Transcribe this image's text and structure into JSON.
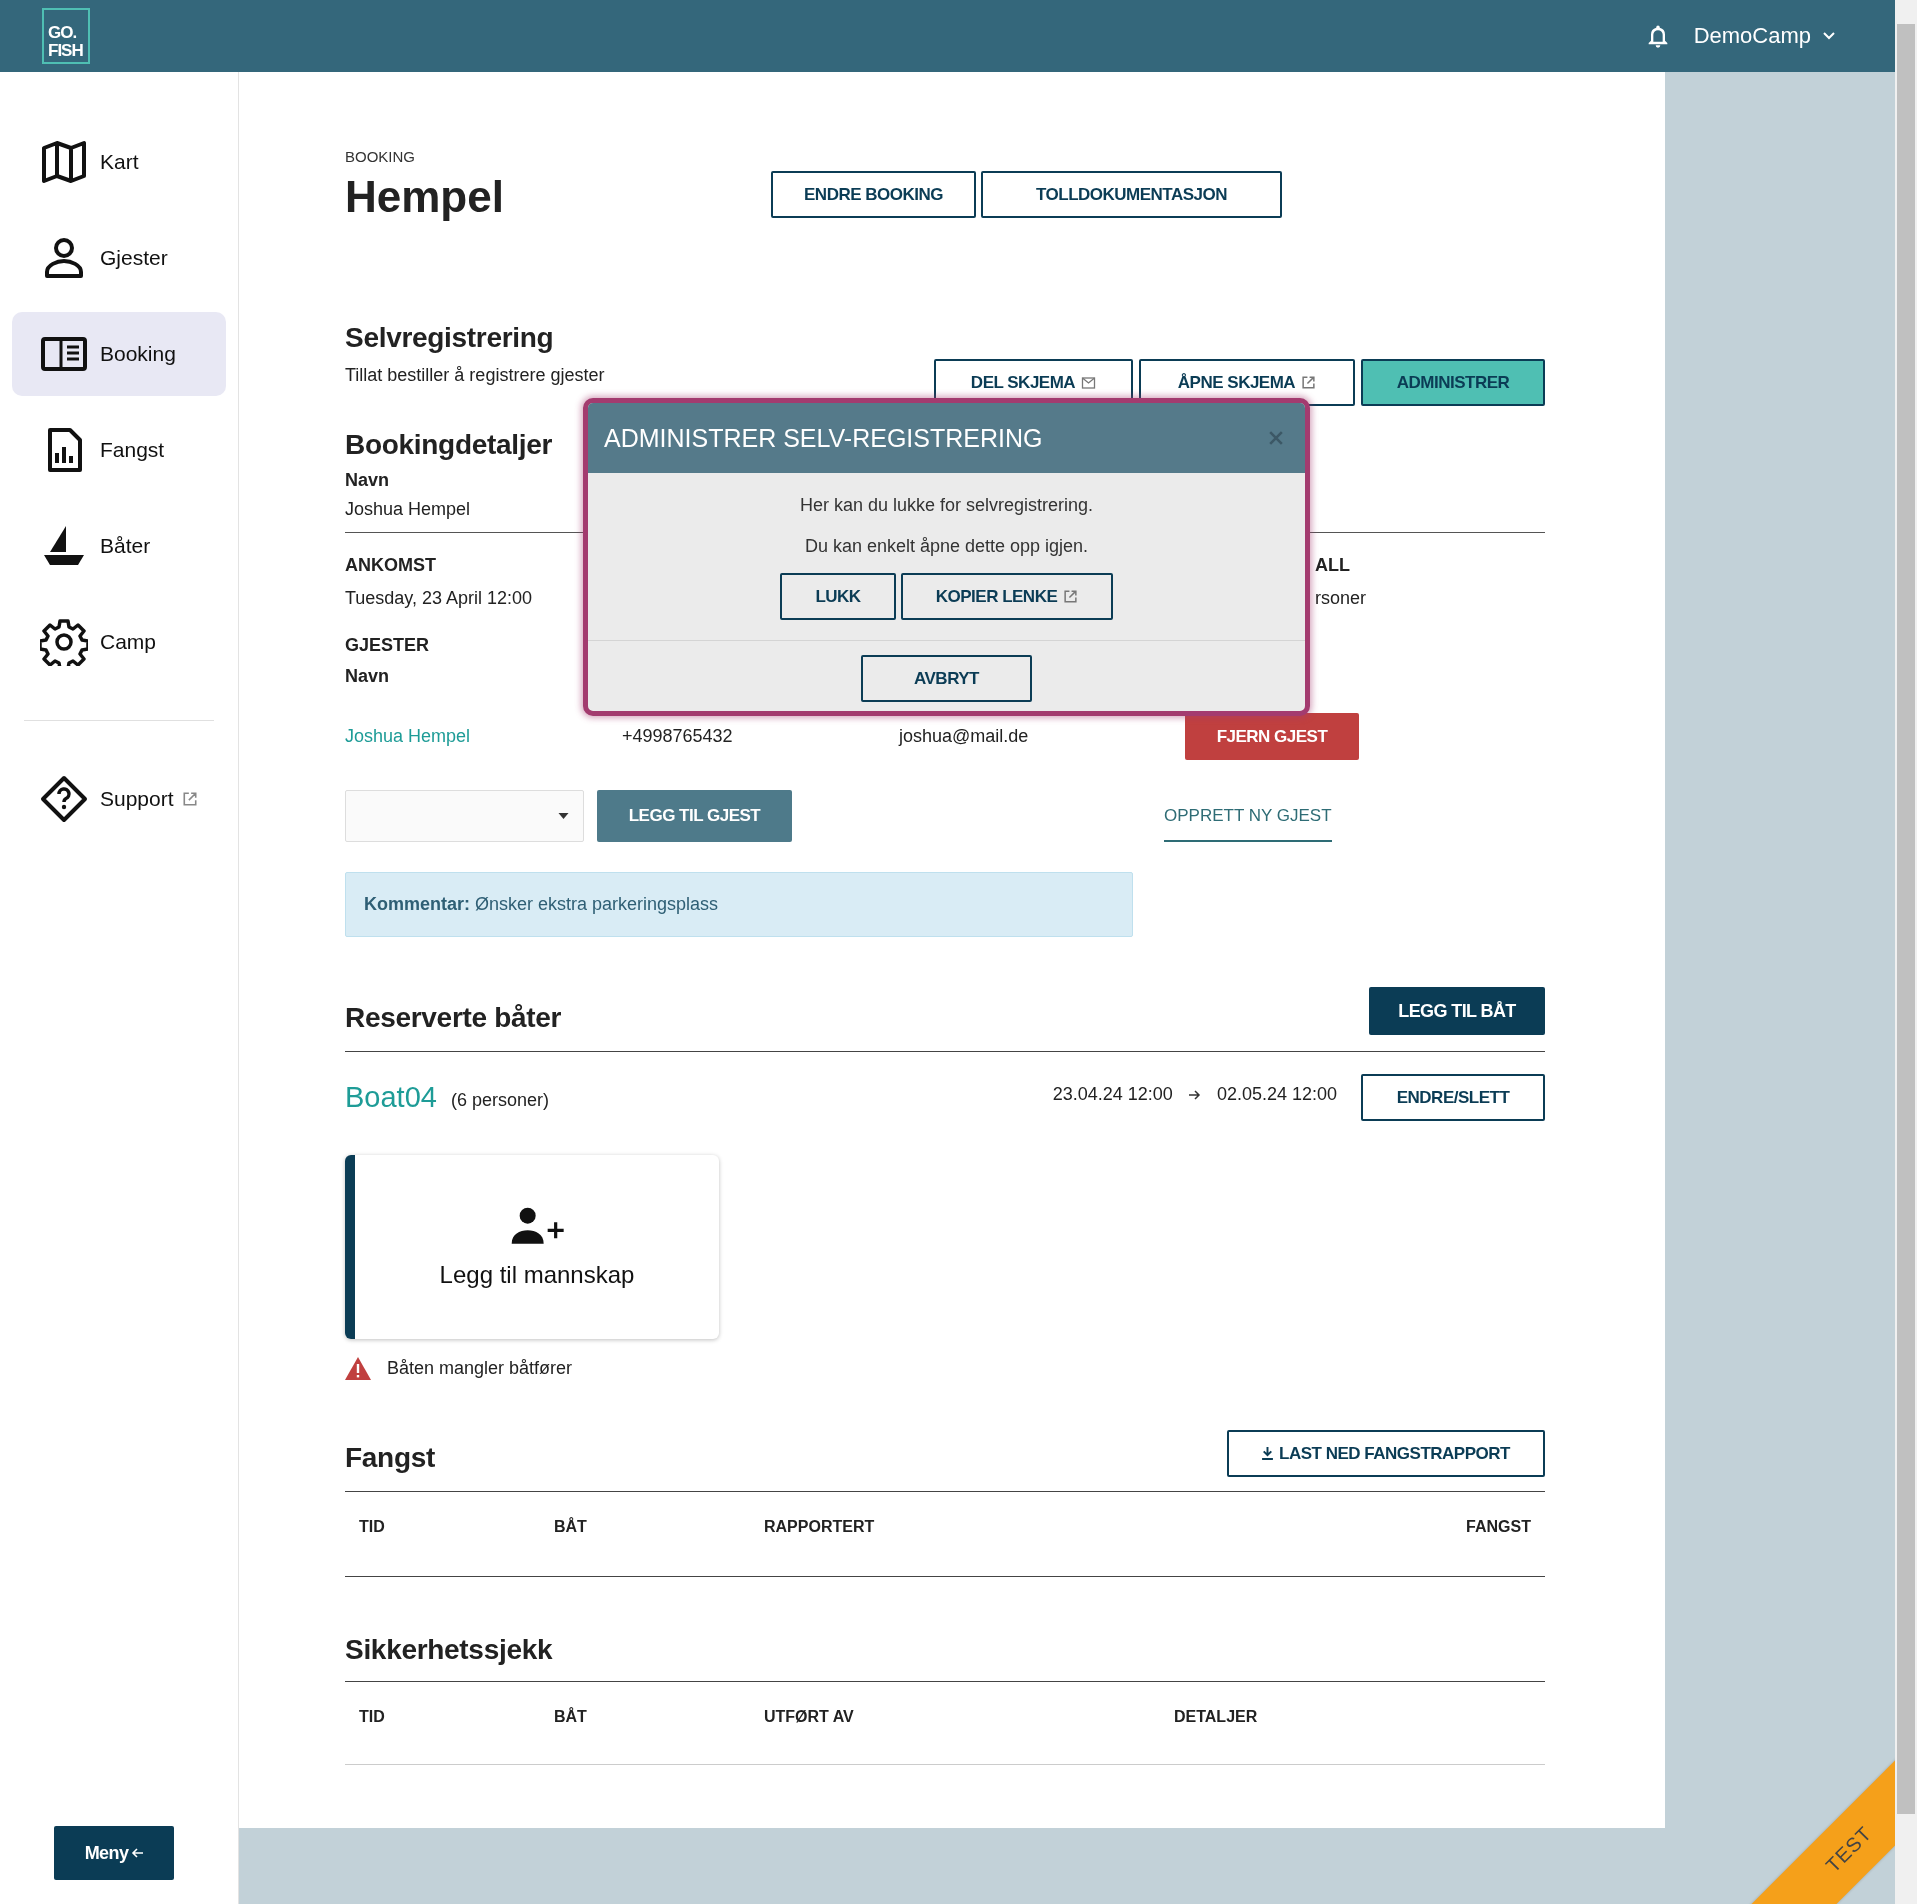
{
  "app_bar": {
    "logo": [
      "GO.",
      "FISH"
    ],
    "account": "DemoCamp"
  },
  "sidebar": {
    "items": [
      {
        "label": "Kart",
        "selected": false
      },
      {
        "label": "Gjester",
        "selected": false
      },
      {
        "label": "Booking",
        "selected": true
      },
      {
        "label": "Fangst",
        "selected": false
      },
      {
        "label": "Båter",
        "selected": false
      },
      {
        "label": "Camp",
        "selected": false
      }
    ],
    "support": "Support",
    "menu_button": "Meny"
  },
  "page": {
    "eyebrow": "BOOKING",
    "title": "Hempel",
    "actions": [
      "ENDRE BOOKING",
      "TOLLDOKUMENTASJON"
    ]
  },
  "self_registration": {
    "title": "Selvregistrering",
    "description": "Tillat bestiller å registrere gjester",
    "buttons": [
      {
        "label": "DEL SKJEMA",
        "kind": "mail"
      },
      {
        "label": "ÅPNE SKJEMA",
        "kind": "external"
      },
      {
        "label": "ADMINISTRER",
        "kind": "primary"
      }
    ]
  },
  "booking_details": {
    "title": "Bookingdetaljer",
    "name_label": "Navn",
    "name": "Joshua Hempel",
    "fields": [
      {
        "label": "ANKOMST",
        "value": "Tuesday, 23 April 12:00"
      },
      {
        "label": "ALL",
        "value": "rsoner"
      }
    ],
    "guests_title": "GJESTER",
    "guests_column": "Navn",
    "guests": [
      {
        "name": "Joshua Hempel",
        "phone": "+4998765432",
        "email": "joshua@mail.de",
        "remove": "FJERN GJEST"
      }
    ],
    "add_guest": "LEGG TIL GJEST",
    "create_guest": "OPPRETT NY GJEST",
    "comment": "**Kommentar:** Ønsker ekstra parkeringsplass"
  },
  "boats": {
    "title": "Reserverte båter",
    "add": "LEGG TIL BÅT",
    "items": [
      {
        "name": "Boat04",
        "capacity": "(6 personer)",
        "from": "23.04.24 12:00",
        "to": "02.05.24 12:00",
        "edit": "ENDRE/SLETT",
        "crew": "Legg til mannskap",
        "warning": "Båten mangler båtfører"
      }
    ]
  },
  "catch": {
    "title": "Fangst",
    "download": "LAST NED FANGSTRAPPORT",
    "columns": [
      "TID",
      "BÅT",
      "RAPPORTERT",
      "FANGST"
    ]
  },
  "safety": {
    "title": "Sikkerhetssjekk",
    "columns": [
      "TID",
      "BÅT",
      "UTFØRT AV",
      "DETALJER"
    ]
  },
  "dialog": {
    "title": "ADMINISTRER SELV-REGISTRERING",
    "lines": [
      "Her kan du lukke for selvregistrering.",
      "Du kan enkelt åpne dette opp igjen."
    ],
    "buttons": [
      {
        "label": "LUKK",
        "kind": "plain"
      },
      {
        "label": "KOPIER LENKE",
        "kind": "external"
      }
    ],
    "cancel": "AVBRYT"
  },
  "ribbon": "TEST"
}
